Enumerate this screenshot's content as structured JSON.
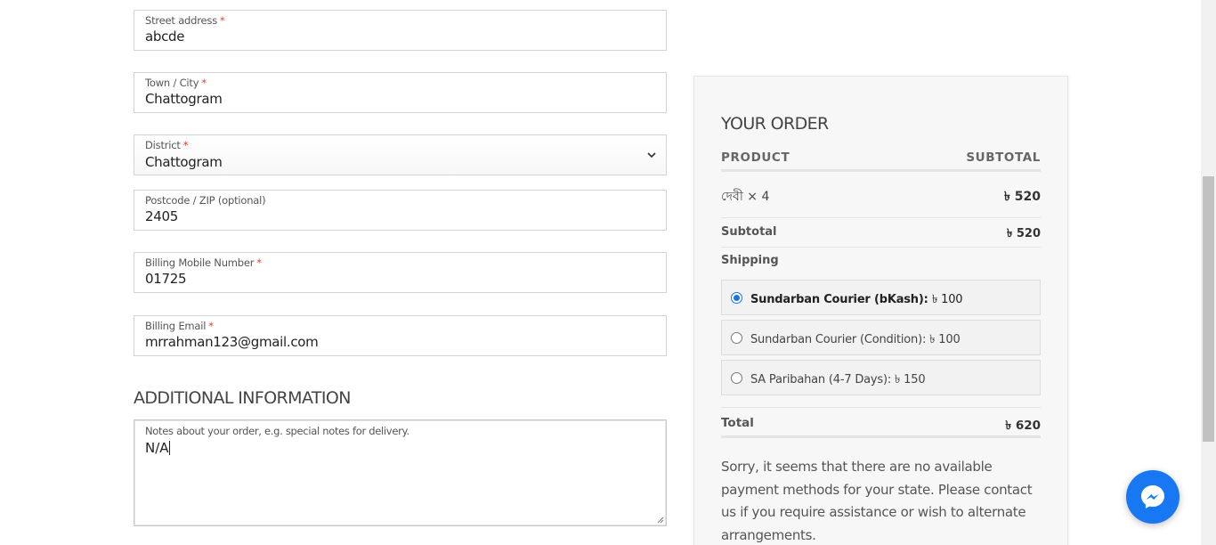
{
  "billing": {
    "street": {
      "label": "Street address",
      "required_mark": "*",
      "value": "abcde"
    },
    "town": {
      "label": "Town / City",
      "required_mark": "*",
      "value": "Chattogram"
    },
    "district": {
      "label": "District",
      "required_mark": "*",
      "value": "Chattogram"
    },
    "postcode": {
      "label": "Postcode / ZIP (optional)",
      "value": "2405"
    },
    "mobile": {
      "label": "Billing Mobile Number",
      "required_mark": "*",
      "value": "01725"
    },
    "email": {
      "label": "Billing Email",
      "required_mark": "*",
      "value": "mrrahman123@gmail.com"
    }
  },
  "additional": {
    "title": "ADDITIONAL INFORMATION",
    "notes_label": "Notes about your order, e.g. special notes for delivery.",
    "notes_value": "N/A"
  },
  "order": {
    "title": "YOUR ORDER",
    "col_product": "PRODUCT",
    "col_subtotal": "SUBTOTAL",
    "item_name": "দেবী × 4",
    "item_total": "৳ 520",
    "subtotal_label": "Subtotal",
    "subtotal_value": "৳ 520",
    "shipping_label": "Shipping",
    "shipping_options": [
      {
        "label": "Sundarban Courier (bKash):",
        "price": "৳ 100",
        "selected": true
      },
      {
        "label": "Sundarban Courier (Condition):",
        "price": "৳ 100",
        "selected": false
      },
      {
        "label": "SA Paribahan (4-7 Days):",
        "price": "৳ 150",
        "selected": false
      }
    ],
    "total_label": "Total",
    "total_value": "৳ 620",
    "payment_notice": "Sorry, it seems that there are no available payment methods for your state. Please contact us if you require assistance or wish to alternate arrangements."
  },
  "colors": {
    "accent": "#1a73e8",
    "messenger": "#1877f2",
    "required": "#e2401c"
  },
  "icons": {
    "messenger": "messenger-icon",
    "select_arrow": "chevron-down-icon"
  }
}
